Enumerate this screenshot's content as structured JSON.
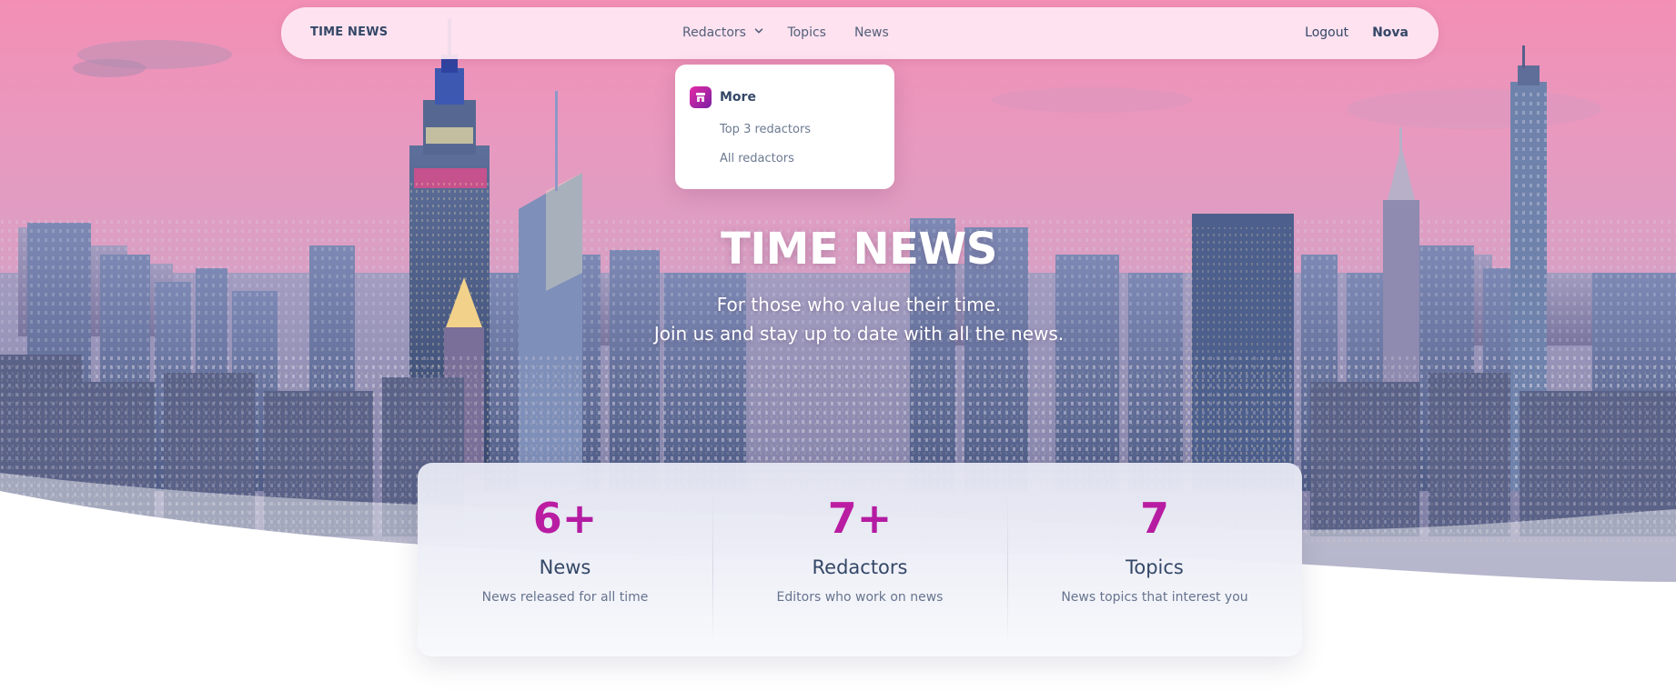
{
  "navbar": {
    "brand": "TIME NEWS",
    "links": [
      {
        "label": "Redactors"
      },
      {
        "label": "Topics"
      },
      {
        "label": "News"
      }
    ],
    "logout": "Logout",
    "user": "Nova"
  },
  "dropdown": {
    "title": "More",
    "items": [
      {
        "label": "Top 3 redactors"
      },
      {
        "label": "All redactors"
      }
    ]
  },
  "hero": {
    "title": "TIME NEWS",
    "subtitle_line1": "For those who value their time.",
    "subtitle_line2": "Join us and stay up to date with all the news."
  },
  "stats": [
    {
      "value": "6+",
      "label": "News",
      "description": "News released for all time"
    },
    {
      "value": "7+",
      "label": "Redactors",
      "description": "Editors who work on news"
    },
    {
      "value": "7",
      "label": "Topics",
      "description": "News topics that interest you"
    }
  ],
  "colors": {
    "accent": "#c01a9a",
    "text_dark": "#344767",
    "text_muted": "#67748e",
    "sky_top": "#f08fb8",
    "sky_bottom": "#c99bbd"
  },
  "icons": {
    "dropdown_icon": "storefront-icon",
    "chevron": "chevron-down-icon"
  }
}
